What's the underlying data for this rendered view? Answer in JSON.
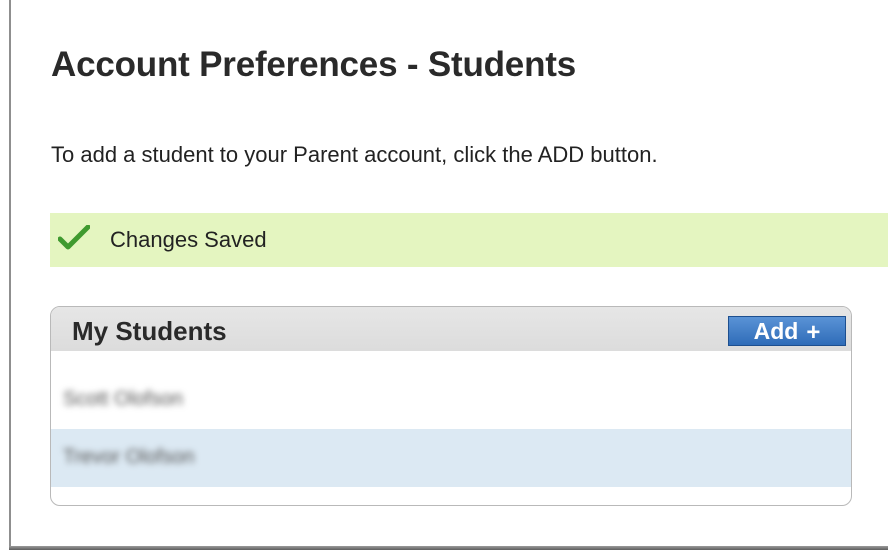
{
  "page": {
    "title": "Account Preferences - Students",
    "instructions": "To add a student to your Parent account, click the ADD button."
  },
  "status": {
    "icon": "checkmark-icon",
    "message": "Changes Saved",
    "color": "#4caf50",
    "background": "#e4f5c0"
  },
  "students_panel": {
    "title": "My Students",
    "add_button_label": "Add",
    "add_icon": "plus-icon",
    "rows": [
      {
        "name": "Scott Olofson",
        "selected": false
      },
      {
        "name": "Trevor Olofson",
        "selected": true
      }
    ],
    "selected_row_color": "#dce9f3",
    "accent": "#2f6cb8"
  }
}
